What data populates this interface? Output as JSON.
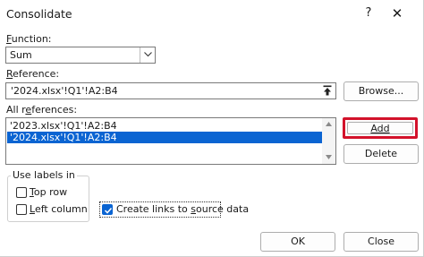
{
  "window": {
    "title": "Consolidate",
    "help_glyph": "?",
    "close_glyph": "✕"
  },
  "function": {
    "label_prefix": "",
    "label_key": "F",
    "label_rest": "unction:",
    "selected": "Sum"
  },
  "reference": {
    "label_key": "R",
    "label_rest": "eference:",
    "value": "'2024.xlsx'!Q1'!A2:B4"
  },
  "browse_label": "Browse...",
  "all_references": {
    "label_pre": "All r",
    "label_key": "e",
    "label_rest": "ferences:",
    "items": [
      "'2023.xlsx'!Q1'!A2:B4",
      "'2024.xlsx'!Q1'!A2:B4"
    ],
    "selected_index": 1
  },
  "add_label": "Add",
  "delete_label": "Delete",
  "use_labels": {
    "legend": "Use labels in",
    "top_row": {
      "key": "T",
      "rest": "op row",
      "checked": false
    },
    "left_column": {
      "key": "L",
      "rest": "eft column",
      "checked": false
    }
  },
  "create_links": {
    "pre": "Create links to ",
    "key": "s",
    "rest": "ource data",
    "checked": true
  },
  "ok_label": "OK",
  "close_label": "Close",
  "colors": {
    "highlight": "#0a64d2",
    "add_outline": "#d3122b"
  }
}
